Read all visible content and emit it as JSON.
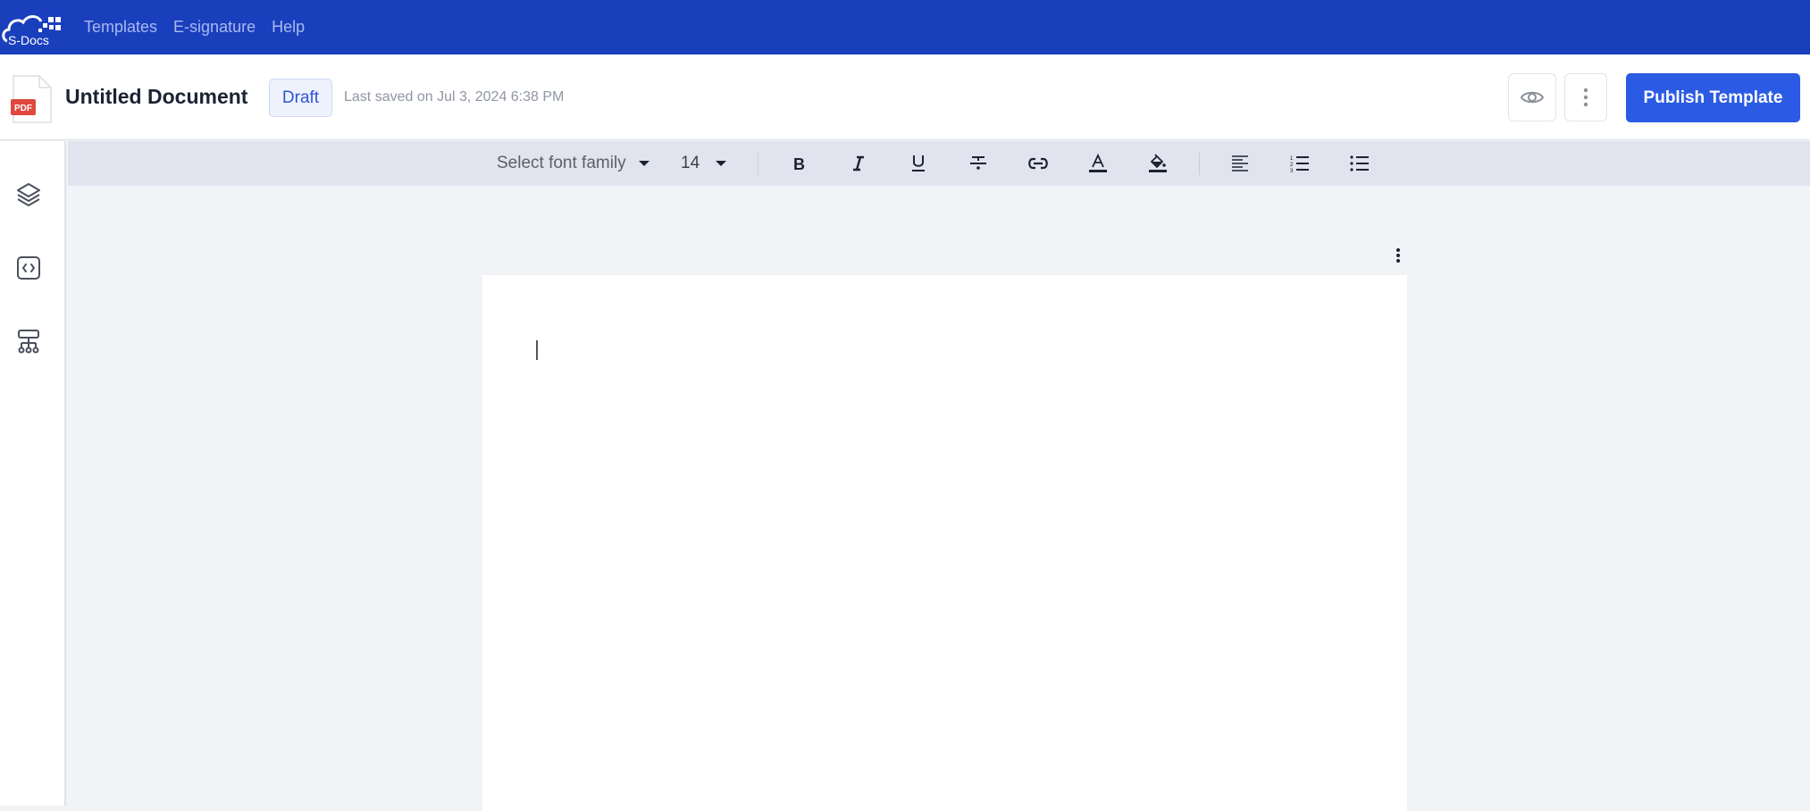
{
  "app": {
    "logo_text": "S-Docs",
    "nav": [
      {
        "label": "Templates"
      },
      {
        "label": "E-signature"
      },
      {
        "label": "Help"
      }
    ]
  },
  "document": {
    "file_type_icon": "pdf-file-icon",
    "file_type_label": "PDF",
    "title": "Untitled Document",
    "status_badge": "Draft",
    "last_saved": "Last saved on Jul 3, 2024 6:38 PM",
    "actions": {
      "preview_icon": "eye-icon",
      "more_icon": "kebab-vertical-icon",
      "publish_label": "Publish Template"
    }
  },
  "sidebar": {
    "items": [
      {
        "name": "layers",
        "icon": "layers-icon"
      },
      {
        "name": "code",
        "icon": "code-icon"
      },
      {
        "name": "hierarchy",
        "icon": "hierarchy-icon"
      }
    ]
  },
  "toolbar": {
    "font_family": "Select font family",
    "font_size": "14",
    "buttons": [
      "bold",
      "italic",
      "underline",
      "strikethrough",
      "link",
      "text-color",
      "highlight-color",
      "align-left",
      "ordered-list",
      "bullet-list"
    ]
  },
  "colors": {
    "brand": "#1a3fbd",
    "primary_button": "#2b5be4",
    "badge_text": "#2f55d4",
    "pdf_red": "#e0483e"
  }
}
